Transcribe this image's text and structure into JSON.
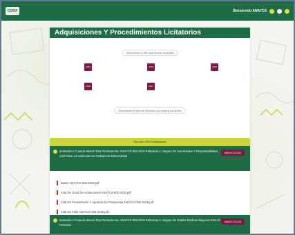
{
  "header": {
    "logo_text": "CDMX",
    "user_name": "Bienvenido ANAYCS",
    "icons": [
      "gear-icon",
      "user-icon",
      "logout-icon"
    ]
  },
  "page": {
    "title": "Adquisiciones Y Procedimientos Licitatorios",
    "select_year_hint": "Seleccione el año que desea consultar",
    "select_type_hint": "Seleccione el tipo de licitación que desea consultar",
    "years": [
      "2021",
      "2020",
      "2019",
      "2018",
      "2017"
    ]
  },
  "section": {
    "header": "Ejercicio 2019 Licitaciones"
  },
  "cards": [
    {
      "description": "Invitación A Cuando Menos Tres Personas No. ANAYCS-002-2019 Referente A: Seguro De Automóviles Y Responsabilidad Civil Para Los Vehículos De Trabajo De Esta Entidad",
      "badge": "ANAYCS-002"
    },
    {
      "description": "Invitación A Cuando Menos Tres Personas No. ANAYCS-003-2019 Referente A: Seguro De Gastos Médicos Mayores Para El Personal",
      "badge": "ANAYCS-003"
    }
  ],
  "documents": [
    "Bases ANAYCS-002-2019.pdf",
    "Acta De Junta De Aclaraciones ANAYCS-002-2019.pdf",
    "Acta De Presentación Y Apertura De Propuestas ANAYCS-002-2019.pdf",
    "Acta De Fallo ANAYCS-002-2019.pdf"
  ],
  "colors": {
    "primary_green": "#1e6b46",
    "accent_lime": "#c7d43a",
    "button_maroon": "#7b1a43",
    "document_marker": "#c0392b"
  }
}
